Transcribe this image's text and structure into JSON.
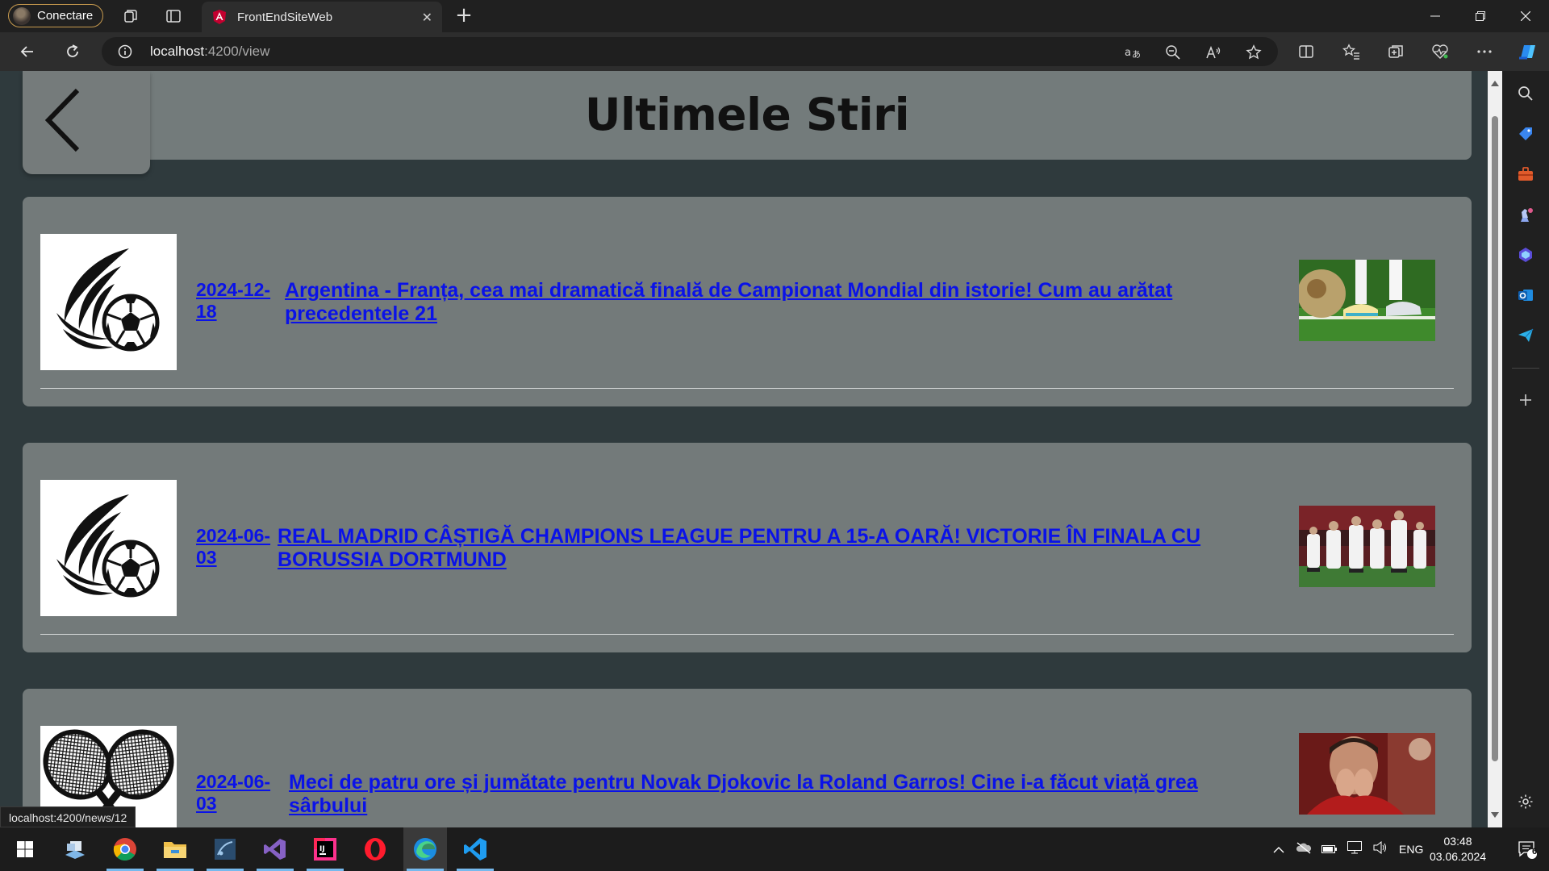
{
  "browser": {
    "profile_label": "Conectare",
    "tab_title": "FrontEndSiteWeb",
    "url_host": "localhost",
    "url_rest": ":4200/view",
    "status_url": "localhost:4200/news/12"
  },
  "page": {
    "title": "Ultimele Stiri",
    "back_icon": "chevron-left-icon"
  },
  "news": [
    {
      "date": "2024-12-18",
      "date_line1": "2024-12-",
      "date_line2": "18",
      "title_line1": "Argentina - Franța, cea mai dramatică finală de Campionat Mondial din istorie! Cum au arătat",
      "title_line2": "precedentele 21",
      "category_icon": "soccer-ball-icon",
      "photo": "football-boots-photo"
    },
    {
      "date": "2024-06-03",
      "date_line1": "2024-06-",
      "date_line2": "03",
      "title_line1": "REAL MADRID CÂȘTIGĂ CHAMPIONS LEAGUE PENTRU A 15-A OARĂ! VICTORIE ÎN FINALA CU",
      "title_line2": "BORUSSIA DORTMUND",
      "category_icon": "soccer-ball-icon",
      "photo": "team-celebration-photo"
    },
    {
      "date": "2024-06-03",
      "date_line1": "2024-06-",
      "date_line2": "03",
      "title_line1": "Meci de patru ore și jumătate pentru Novak Djokovic la Roland Garros! Cine i-a făcut viață grea",
      "title_line2": "sârbului",
      "category_icon": "tennis-rackets-icon",
      "photo": "djokovic-photo"
    }
  ],
  "taskbar": {
    "language": "ENG",
    "time": "03:48",
    "date": "03.06.2024",
    "notification_count": "6"
  },
  "colors": {
    "page_bg": "#2f3a3d",
    "card_bg": "#737a7a",
    "link": "#0a12e8"
  }
}
